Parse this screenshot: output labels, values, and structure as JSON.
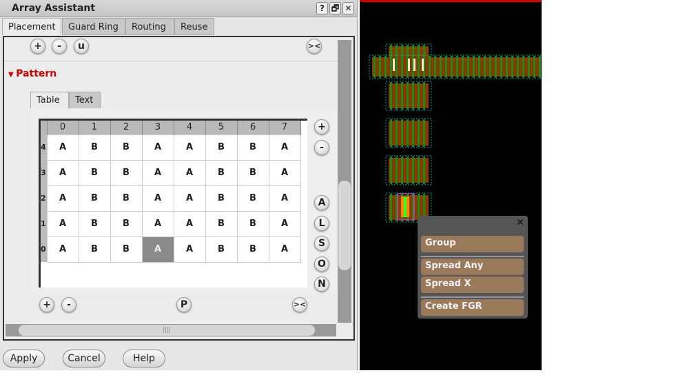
{
  "window": {
    "title": "Array Assistant",
    "help": "?",
    "restore": "🗗",
    "close": "✕"
  },
  "tabs": [
    "Placement",
    "Guard Ring",
    "Routing",
    "Reuse"
  ],
  "toolbar": {
    "add": "+",
    "remove": "-",
    "u": "u",
    "collapse": "><"
  },
  "section": {
    "title": "Pattern"
  },
  "subtabs": [
    "Table",
    "Text"
  ],
  "table": {
    "columns": [
      "0",
      "1",
      "2",
      "3",
      "4",
      "5",
      "6",
      "7"
    ],
    "rows": [
      {
        "label": "4",
        "cells": [
          "A",
          "B",
          "B",
          "A",
          "A",
          "B",
          "B",
          "A"
        ]
      },
      {
        "label": "3",
        "cells": [
          "A",
          "B",
          "B",
          "A",
          "A",
          "B",
          "B",
          "A"
        ]
      },
      {
        "label": "2",
        "cells": [
          "A",
          "B",
          "B",
          "A",
          "A",
          "B",
          "B",
          "A"
        ]
      },
      {
        "label": "1",
        "cells": [
          "A",
          "B",
          "B",
          "A",
          "A",
          "B",
          "B",
          "A"
        ]
      },
      {
        "label": "0",
        "cells": [
          "A",
          "B",
          "B",
          "A",
          "A",
          "B",
          "B",
          "A"
        ]
      }
    ],
    "selected": {
      "row": "0",
      "column": "3"
    }
  },
  "side_buttons": {
    "add": "+",
    "remove": "-",
    "letters": [
      "A",
      "L",
      "S",
      "O",
      "N"
    ]
  },
  "bottom_row": {
    "add": "+",
    "remove": "-",
    "p": "P",
    "collapse": "><"
  },
  "footer": {
    "apply": "Apply",
    "cancel": "Cancel",
    "help": "Help"
  },
  "popup": {
    "close": "✕",
    "items": [
      "Group",
      "Spread Any",
      "Spread X",
      "Create FGR"
    ]
  },
  "colors": {
    "diffusion": "#8a3a00",
    "poly": "#1a8a1a",
    "highlight": "#ff33ff",
    "menu": "#9b7a5b"
  }
}
